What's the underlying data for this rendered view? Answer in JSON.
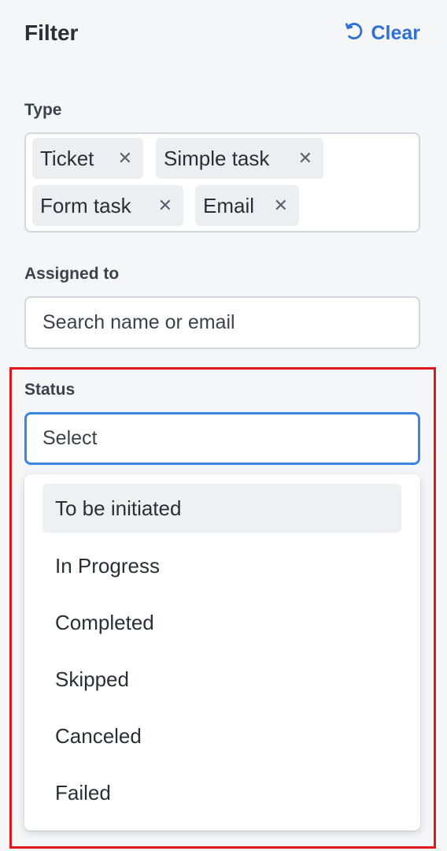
{
  "header": {
    "title": "Filter",
    "clear_label": "Clear"
  },
  "type": {
    "label": "Type",
    "chips": [
      "Ticket",
      "Simple task",
      "Form task",
      "Email"
    ],
    "remove_glyph": "✕"
  },
  "assigned": {
    "label": "Assigned to",
    "placeholder": "Search name or email"
  },
  "status": {
    "label": "Status",
    "placeholder": "Select",
    "options": [
      "To be initiated",
      "In Progress",
      "Completed",
      "Skipped",
      "Canceled",
      "Failed"
    ],
    "hovered_option_index": 0
  },
  "colors": {
    "accent": "#2f6fd6",
    "focus_border": "#3a86e3",
    "annotation_red": "#e0181c",
    "background": "#f5f6f8"
  },
  "icons": {
    "clear": "refresh-icon",
    "remove": "close-icon"
  }
}
